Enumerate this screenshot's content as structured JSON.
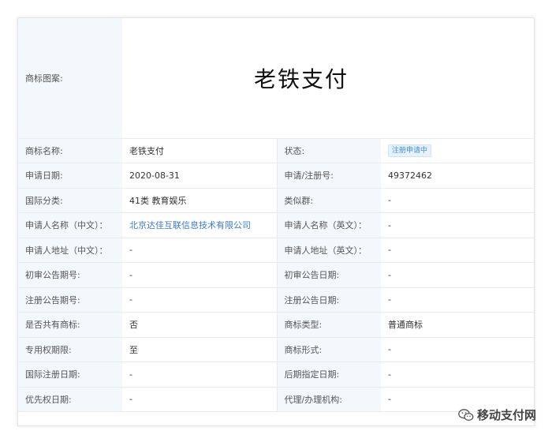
{
  "logo": {
    "label": "商标图案:",
    "text": "老铁支付"
  },
  "rows": [
    {
      "l1": "商标名称:",
      "v1": "老铁支付",
      "l2": "状态:",
      "v2": "注册申请中"
    },
    {
      "l1": "申请日期:",
      "v1": "2020-08-31",
      "l2": "申请/注册号:",
      "v2": "49372462"
    },
    {
      "l1": "国际分类:",
      "v1": "41类 教育娱乐",
      "l2": "类似群:",
      "v2": "-"
    },
    {
      "l1": "申请人名称（中文）：",
      "v1": "北京达佳互联信息技术有限公司",
      "l2": "申请人名称（英文）：",
      "v2": "-"
    },
    {
      "l1": "申请人地址（中文）：",
      "v1": "-",
      "l2": "申请人地址（英文）：",
      "v2": "-"
    },
    {
      "l1": "初审公告期号:",
      "v1": "-",
      "l2": "初审公告日期:",
      "v2": "-"
    },
    {
      "l1": "注册公告期号:",
      "v1": "-",
      "l2": "注册公告日期:",
      "v2": "-"
    },
    {
      "l1": "是否共有商标:",
      "v1": "否",
      "l2": "商标类型:",
      "v2": "普通商标"
    },
    {
      "l1": "专用权期限:",
      "v1": "至",
      "l2": "商标形式:",
      "v2": "-"
    },
    {
      "l1": "国际注册日期:",
      "v1": "-",
      "l2": "后期指定日期:",
      "v2": "-"
    },
    {
      "l1": "优先权日期:",
      "v1": "-",
      "l2": "代理/办理机构:",
      "v2": "-"
    }
  ],
  "watermark": {
    "text": "移动支付网",
    "icon": "wechat-icon"
  },
  "colors": {
    "label_bg": "#f3f8fc",
    "link": "#3a7dd6",
    "badge": "#3a8ee6"
  }
}
